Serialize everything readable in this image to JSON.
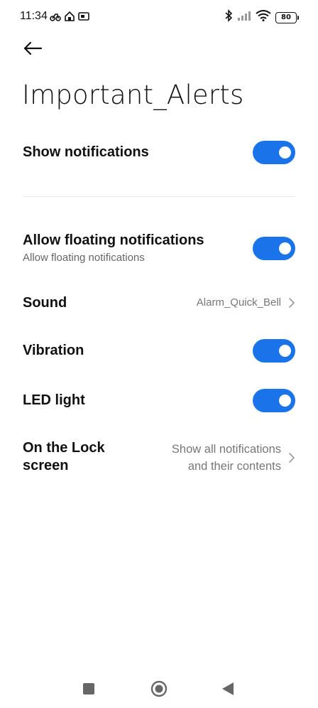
{
  "status_bar": {
    "time": "11:34",
    "battery": "80",
    "icons": [
      "scooter-icon",
      "home-signal-icon",
      "cast-icon",
      "bluetooth-icon",
      "signal-icon",
      "wifi-icon",
      "battery-icon"
    ]
  },
  "header": {
    "back_icon": "arrow-left-icon",
    "title": "Important_Alerts"
  },
  "settings": {
    "show_notifications": {
      "label": "Show notifications",
      "enabled": true
    },
    "floating": {
      "label": "Allow floating notifications",
      "sublabel": "Allow floating notifications",
      "enabled": true
    },
    "sound": {
      "label": "Sound",
      "value": "Alarm_Quick_Bell"
    },
    "vibration": {
      "label": "Vibration",
      "enabled": true
    },
    "led": {
      "label": "LED light",
      "enabled": true
    },
    "lock_screen": {
      "label_line1": "On the Lock",
      "label_line2": "screen",
      "value_line1": "Show all notifications",
      "value_line2": "and their contents"
    }
  },
  "colors": {
    "accent": "#1a73e8",
    "text": "#111111",
    "secondary_text": "#777777"
  },
  "nav_bar": {
    "icons": [
      "square-recents-icon",
      "circle-home-icon",
      "triangle-back-icon"
    ]
  }
}
